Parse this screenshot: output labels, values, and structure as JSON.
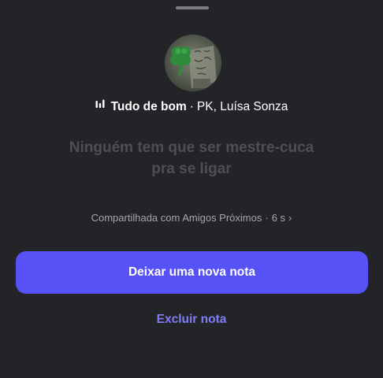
{
  "note": {
    "song_title": "Tudo de bom",
    "separator": "·",
    "artists": "PK, Luísa Sonza",
    "lyrics_line1": "Ninguém tem que ser mestre-cuca",
    "lyrics_line2": "pra se ligar",
    "shared_with": "Compartilhada com Amigos Próximos",
    "shared_dot": "·",
    "time_ago": "6 s",
    "chevron": "›"
  },
  "actions": {
    "new_note_label": "Deixar uma nova nota",
    "delete_note_label": "Excluir nota"
  },
  "colors": {
    "background": "#232427",
    "primary_button": "#5752f5",
    "link": "#7f7cf6",
    "lyrics_dim": "#4e4f53"
  },
  "icons": {
    "music": "music-bars-icon",
    "avatar_art": "four-leaf-clover"
  }
}
